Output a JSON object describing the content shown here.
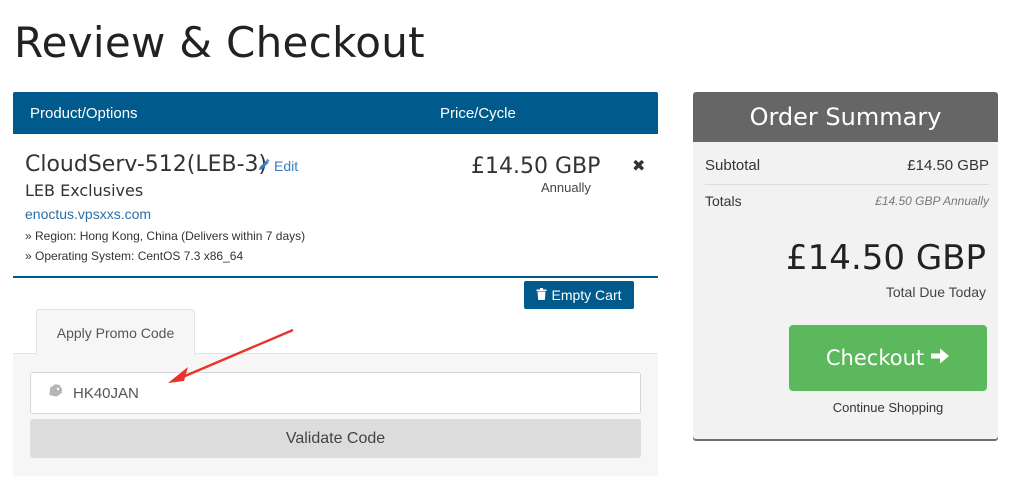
{
  "page": {
    "title": "Review & Checkout"
  },
  "cart": {
    "header": {
      "product_label": "Product/Options",
      "price_label": "Price/Cycle"
    },
    "item": {
      "name": "CloudServ-512(LEB-3)",
      "edit_label": "Edit",
      "group": "LEB Exclusives",
      "domain": "enoctus.vpsxxs.com",
      "options": [
        "» Region: Hong Kong, China (Delivers within 7 days)",
        "» Operating System: CentOS 7.3 x86_64"
      ],
      "price": "£14.50 GBP",
      "cycle": "Annually",
      "remove_icon": "times"
    },
    "empty_cart_label": "Empty Cart"
  },
  "promo": {
    "tab_label": "Apply Promo Code",
    "code_value": "HK40JAN",
    "validate_label": "Validate Code"
  },
  "summary": {
    "title": "Order Summary",
    "subtotal_label": "Subtotal",
    "subtotal_value": "£14.50 GBP",
    "totals_label": "Totals",
    "totals_value": "£14.50 GBP Annually",
    "total_due": "£14.50 GBP",
    "total_due_label": "Total Due Today",
    "checkout_label": "Checkout",
    "continue_label": "Continue Shopping"
  },
  "colors": {
    "primary": "#005a8c",
    "success": "#5cb85c",
    "summary_header": "#666666",
    "annotation_arrow": "#e8332a"
  }
}
